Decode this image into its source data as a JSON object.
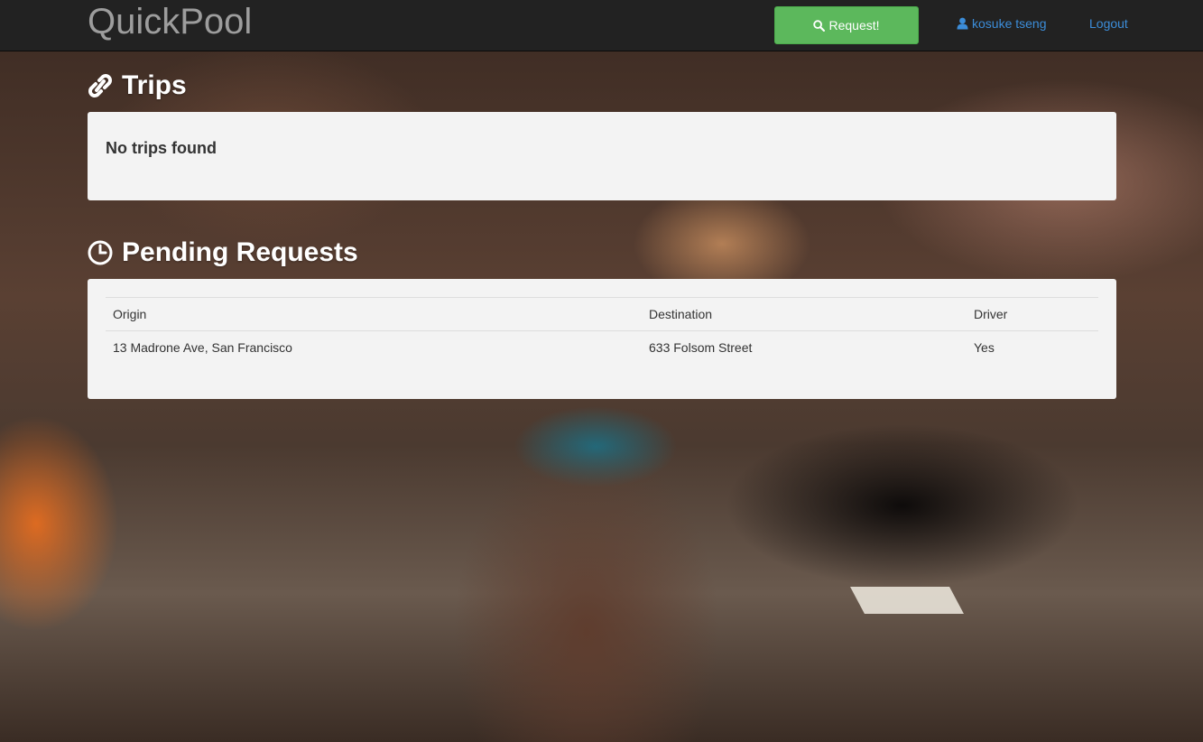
{
  "navbar": {
    "brand": "QuickPool",
    "request_button": "Request!",
    "user_name": "kosuke tseng",
    "logout": "Logout"
  },
  "trips": {
    "title": "Trips",
    "empty_message": "No trips found"
  },
  "pending": {
    "title": "Pending Requests",
    "columns": [
      "Origin",
      "Destination",
      "Driver"
    ],
    "rows": [
      [
        "13 Madrone Ave, San Francisco",
        "633 Folsom Street",
        "Yes"
      ]
    ]
  },
  "colors": {
    "navbar_bg": "#222222",
    "brand": "#9d9d9d",
    "button_green": "#5cb85c",
    "link_blue": "#3c8dd9",
    "panel_bg": "#f3f3f3"
  },
  "icons": {
    "request_button": "search-icon",
    "user": "user-icon",
    "trips": "link-icon",
    "pending": "clock-icon"
  }
}
